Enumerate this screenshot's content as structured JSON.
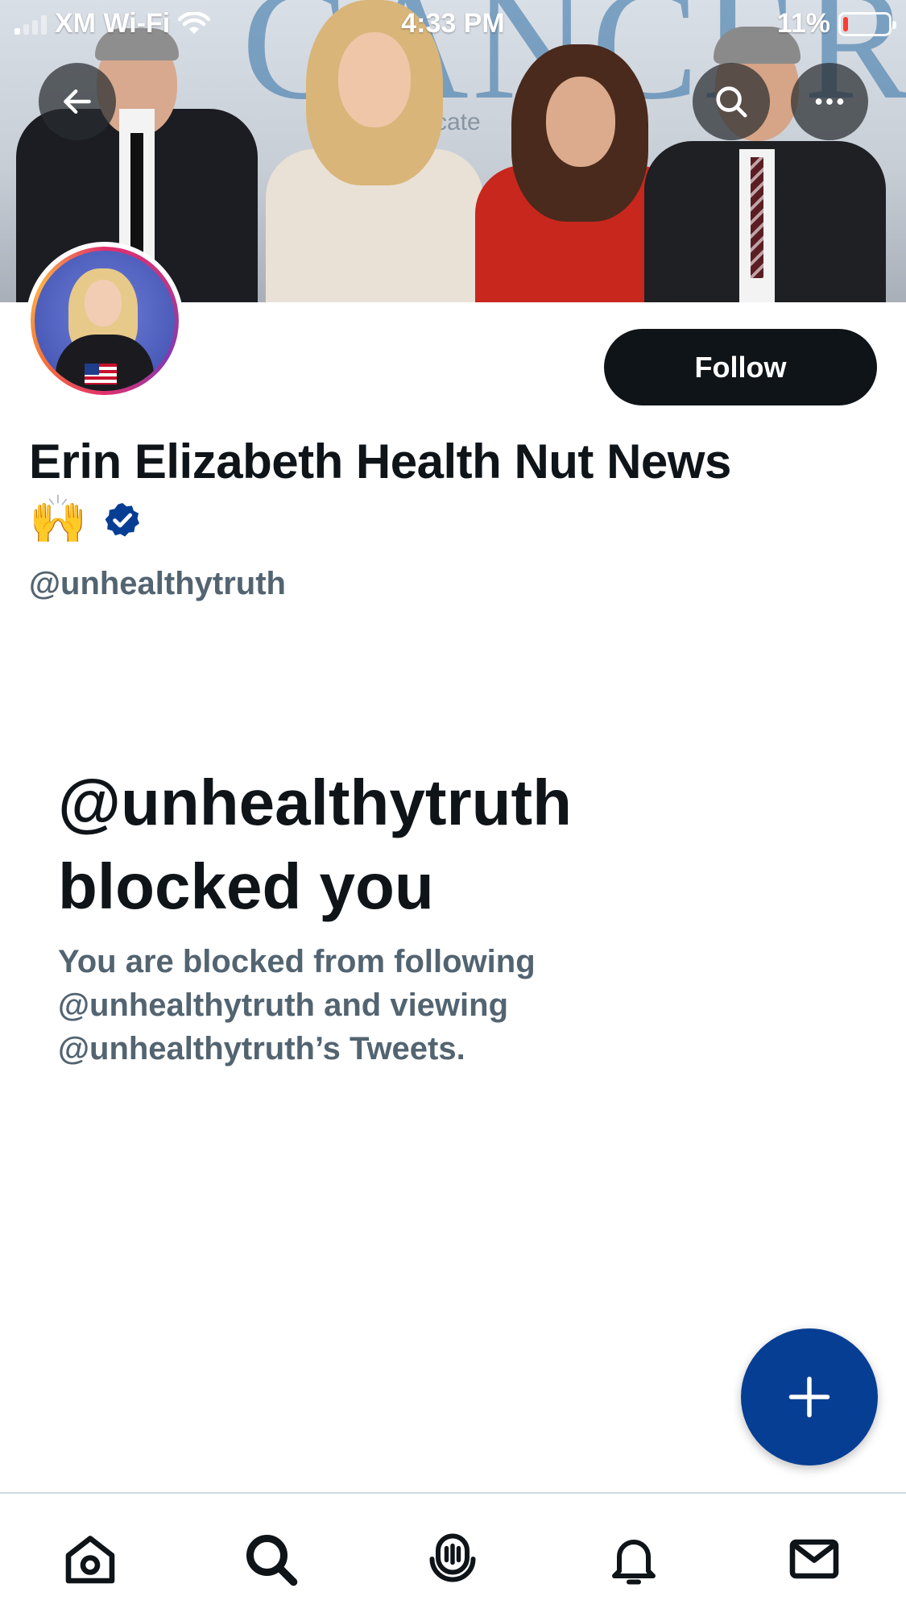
{
  "status_bar": {
    "carrier": "XM Wi-Fi",
    "time": "4:33 PM",
    "battery_percent": "11%",
    "battery_level": 0.11,
    "battery_color": "#ff3b30"
  },
  "banner": {
    "backdrop_text": "CANCER",
    "backdrop_subtext": "cate"
  },
  "top_buttons": {
    "back_icon": "arrow-left-icon",
    "search_icon": "search-icon",
    "more_icon": "more-horizontal-icon"
  },
  "profile": {
    "display_name": "Erin Elizabeth Health Nut News",
    "name_emoji": "🙌",
    "verified_icon": "verified-badge-icon",
    "verified_color": "#063e94",
    "handle": "@unhealthytruth",
    "follow_label": "Follow"
  },
  "blocked": {
    "title": "@unhealthytruth blocked you",
    "description": "You are blocked from following @unhealthytruth and viewing @unhealthytruth’s Tweets."
  },
  "fab": {
    "icon": "plus-icon",
    "color": "#063e94"
  },
  "tab_bar": {
    "tabs": [
      {
        "name": "home",
        "icon": "home-icon"
      },
      {
        "name": "search",
        "icon": "search-icon"
      },
      {
        "name": "spaces",
        "icon": "spaces-icon"
      },
      {
        "name": "notifications",
        "icon": "bell-icon"
      },
      {
        "name": "messages",
        "icon": "mail-icon"
      }
    ]
  }
}
